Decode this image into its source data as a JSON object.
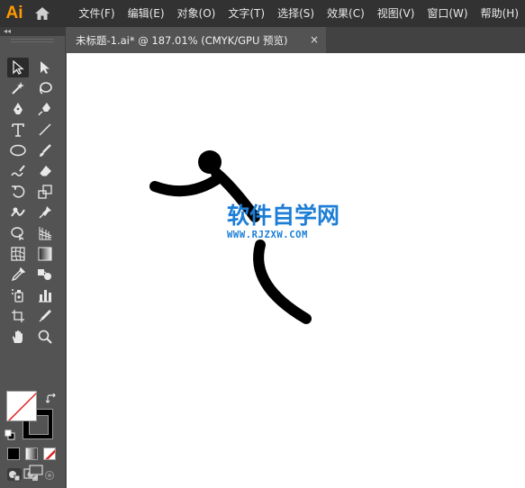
{
  "app": {
    "logo": "Ai"
  },
  "menu": [
    "文件(F)",
    "编辑(E)",
    "对象(O)",
    "文字(T)",
    "选择(S)",
    "效果(C)",
    "视图(V)",
    "窗口(W)",
    "帮助(H)"
  ],
  "toolbar": {
    "collapse_label": "◂◂"
  },
  "document": {
    "tab_title": "未标题-1.ai* @ 187.01% (CMYK/GPU 预览)",
    "close_label": "×"
  },
  "watermark": {
    "title": "软件自学网",
    "url": "WWW.RJZXW.COM"
  },
  "colors": {
    "accent": "#ff9a00",
    "watermark": "#1c7ed6",
    "canvas": "#ffffff",
    "chrome": "#323232"
  }
}
